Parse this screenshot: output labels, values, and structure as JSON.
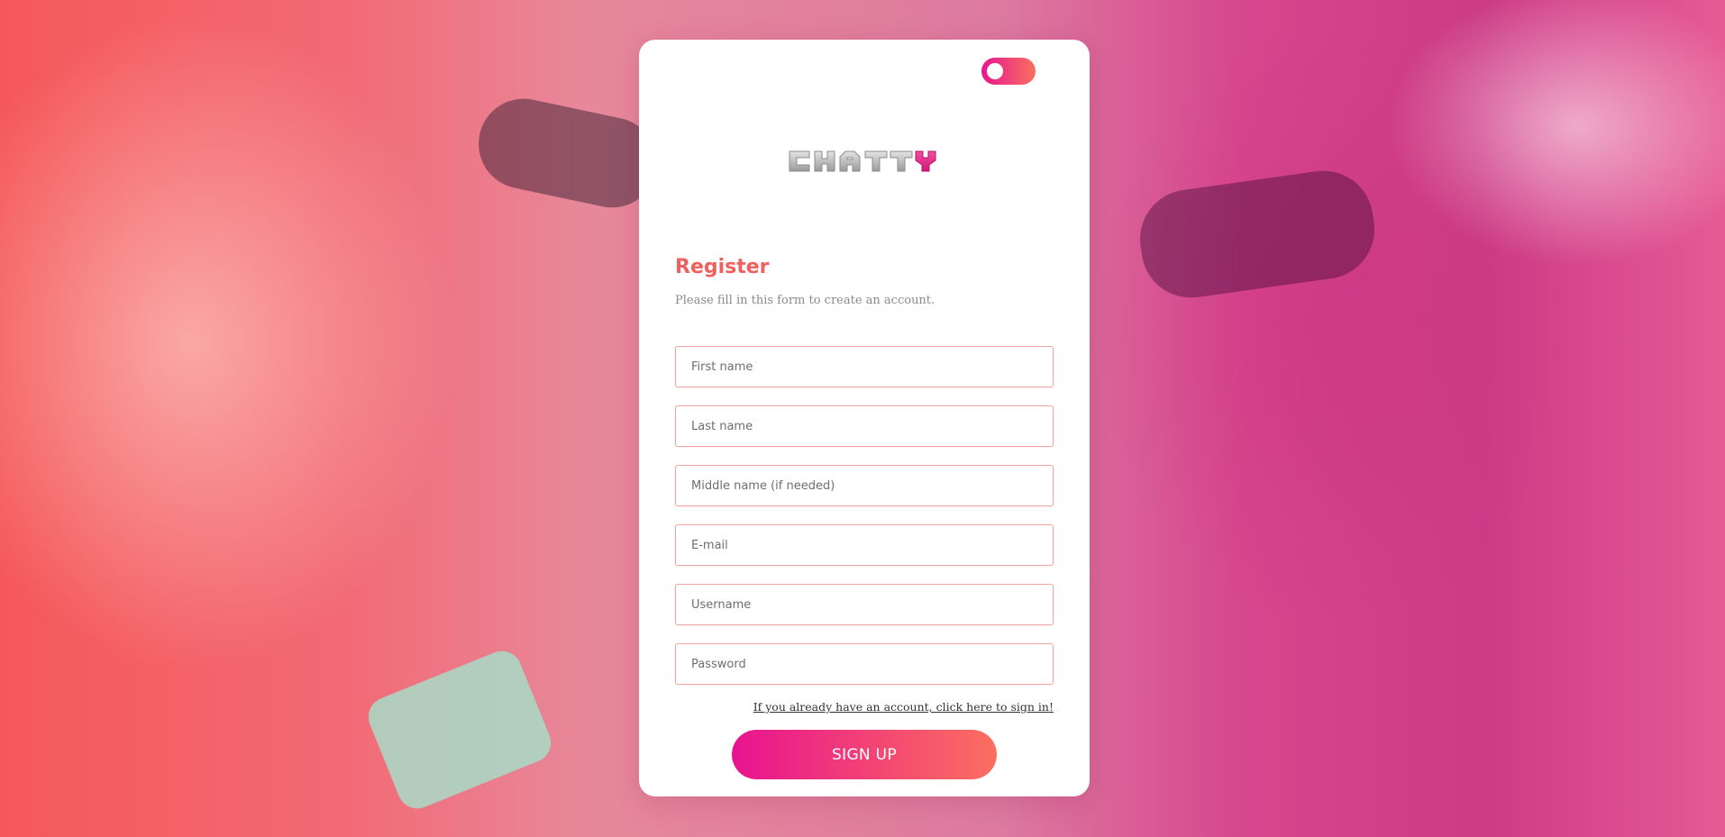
{
  "app": {
    "logo_text": "CHATTY",
    "theme_toggle_state": "off"
  },
  "form": {
    "title": "Register",
    "subtitle": "Please fill in this form to create an account.",
    "fields": {
      "first_name": "First name",
      "last_name": "Last name",
      "middle_name": "Middle name (if needed)",
      "email": "E-mail",
      "username": "Username",
      "password": "Password"
    },
    "signin_link": "If you already have an account, click here to sign in!",
    "submit_label": "SIGN UP"
  },
  "colors": {
    "accent_red": "#f0605f",
    "gradient_start": "#e8138f",
    "gradient_end": "#fb6f5f",
    "field_border": "#f3a3a3"
  }
}
